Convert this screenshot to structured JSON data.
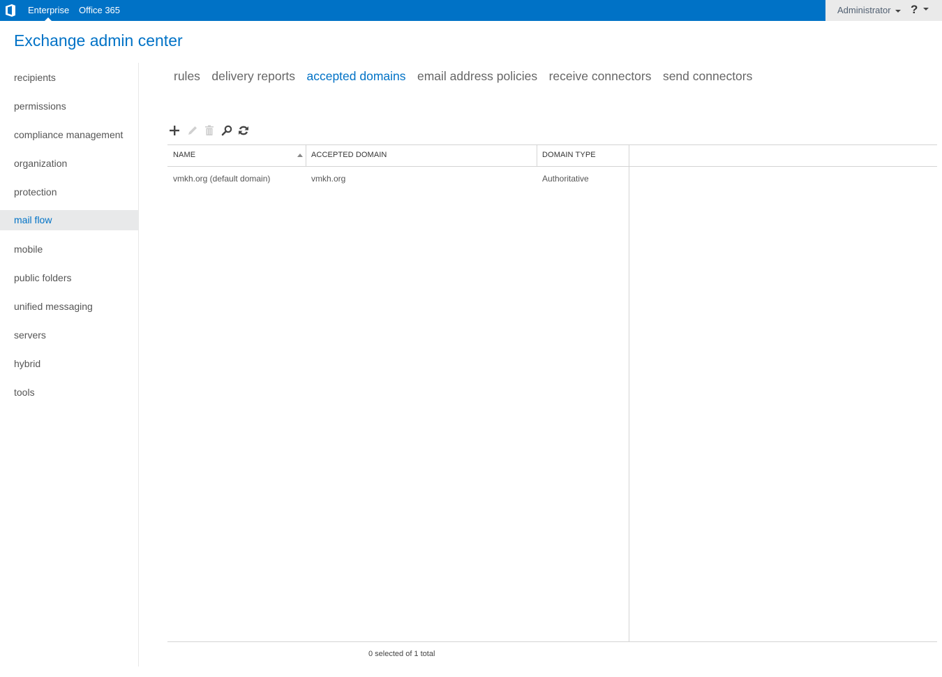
{
  "topbar": {
    "logo_icon": "office-logo-icon",
    "links": [
      "Enterprise",
      "Office 365"
    ],
    "user": "Administrator",
    "help": "?",
    "brand_color": "#0072c6"
  },
  "header": {
    "title": "Exchange admin center"
  },
  "sidebar": {
    "active": "mail flow",
    "items": [
      {
        "label": "recipients"
      },
      {
        "label": "permissions"
      },
      {
        "label": "compliance management"
      },
      {
        "label": "organization"
      },
      {
        "label": "protection"
      },
      {
        "label": "mail flow"
      },
      {
        "label": "mobile"
      },
      {
        "label": "public folders"
      },
      {
        "label": "unified messaging"
      },
      {
        "label": "servers"
      },
      {
        "label": "hybrid"
      },
      {
        "label": "tools"
      }
    ]
  },
  "tabs": {
    "active": "accepted domains",
    "items": [
      {
        "label": "rules"
      },
      {
        "label": "delivery reports"
      },
      {
        "label": "accepted domains"
      },
      {
        "label": "email address policies"
      },
      {
        "label": "receive connectors"
      },
      {
        "label": "send connectors"
      }
    ]
  },
  "toolbar": {
    "buttons": [
      {
        "icon": "add-icon",
        "enabled": true
      },
      {
        "icon": "edit-icon",
        "enabled": false
      },
      {
        "icon": "delete-icon",
        "enabled": false
      },
      {
        "icon": "search-icon",
        "enabled": true
      },
      {
        "icon": "refresh-icon",
        "enabled": true
      }
    ]
  },
  "grid": {
    "columns": [
      {
        "label": "NAME",
        "sorted": "ascending"
      },
      {
        "label": "ACCEPTED DOMAIN"
      },
      {
        "label": "DOMAIN TYPE"
      }
    ],
    "rows": [
      {
        "name": "vmkh.org (default domain)",
        "accepted_domain": "vmkh.org",
        "domain_type": "Authoritative"
      }
    ]
  },
  "status": {
    "text": "0 selected of 1 total"
  }
}
